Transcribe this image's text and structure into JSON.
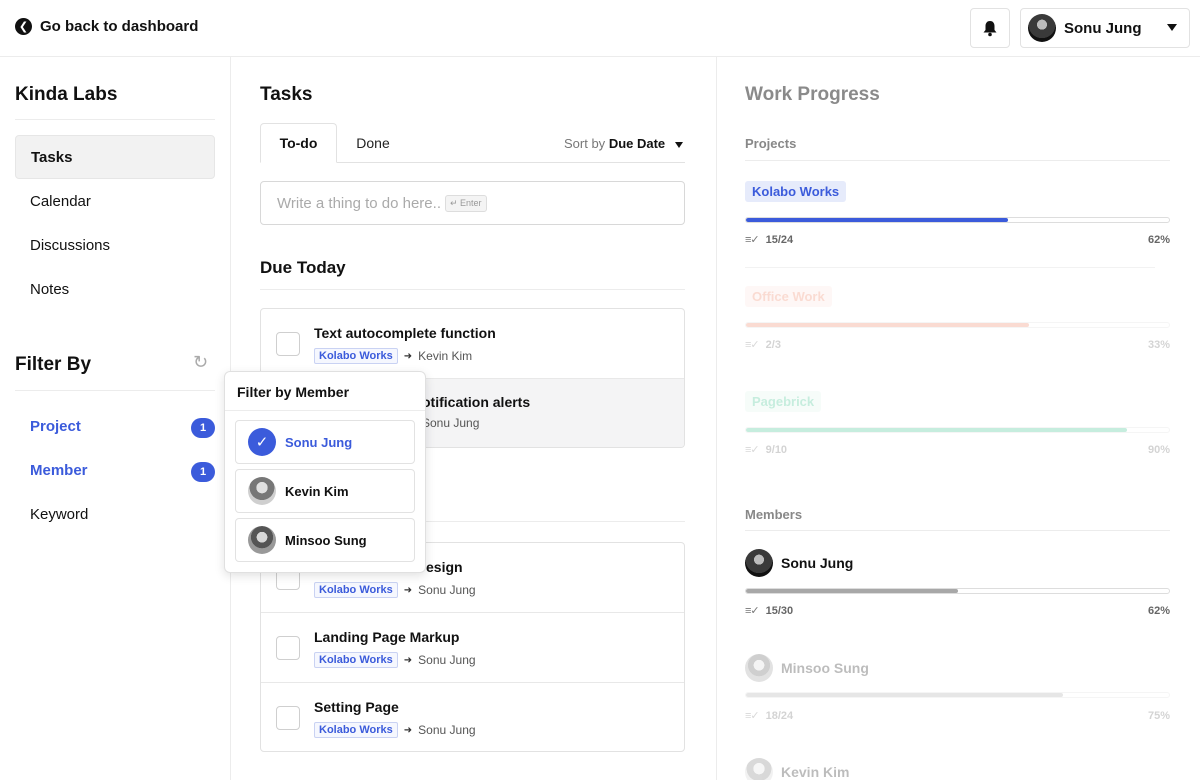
{
  "topbar": {
    "back_label": "Go back to dashboard",
    "user_name": "Sonu Jung"
  },
  "sidebar": {
    "org_name": "Kinda Labs",
    "nav": [
      {
        "label": "Tasks",
        "active": true
      },
      {
        "label": "Calendar"
      },
      {
        "label": "Discussions"
      },
      {
        "label": "Notes"
      }
    ],
    "filter_title": "Filter By",
    "filters": [
      {
        "label": "Project",
        "count": "1"
      },
      {
        "label": "Member",
        "count": "1"
      },
      {
        "label": "Keyword"
      }
    ]
  },
  "tasks": {
    "title": "Tasks",
    "tabs": [
      {
        "label": "To-do"
      },
      {
        "label": "Done"
      }
    ],
    "sort_prefix": "Sort by",
    "sort_value": "Due Date",
    "input_placeholder": "Write a thing to do here..",
    "enter_hint": "↵ Enter",
    "due_today_title": "Due Today",
    "due_today": [
      {
        "title": "Text autocomplete function",
        "project": "Kolabo Works",
        "assignee": "Kevin Kim"
      },
      {
        "title": "otification alerts",
        "project": "",
        "assignee": "Sonu Jung"
      }
    ],
    "later": [
      {
        "title": "esign",
        "project": "Kolabo Works",
        "assignee": "Sonu Jung"
      },
      {
        "title": "Landing Page Markup",
        "project": "Kolabo Works",
        "assignee": "Sonu Jung"
      },
      {
        "title": "Setting Page",
        "project": "Kolabo Works",
        "assignee": "Sonu Jung"
      }
    ]
  },
  "popover": {
    "title": "Filter by Member",
    "members": [
      {
        "name": "Sonu Jung",
        "selected": true
      },
      {
        "name": "Kevin Kim"
      },
      {
        "name": "Minsoo Sung"
      }
    ]
  },
  "progress": {
    "title": "Work Progress",
    "projects_label": "Projects",
    "projects": [
      {
        "name": "Kolabo Works",
        "done": "15/24",
        "pct": "62%",
        "fraction": 0.62,
        "color": "#3b5bdb",
        "bg": "#e6ebfb"
      },
      {
        "name": "Office Work",
        "done": "2/3",
        "pct": "33%",
        "fraction": 0.67,
        "color": "#f08060",
        "bg": "#fde6df"
      },
      {
        "name": "Pagebrick",
        "done": "9/10",
        "pct": "90%",
        "fraction": 0.9,
        "color": "#36c28a",
        "bg": "#dff5ea"
      }
    ],
    "members_label": "Members",
    "members": [
      {
        "name": "Sonu Jung",
        "done": "15/30",
        "pct": "62%",
        "fraction": 0.5
      },
      {
        "name": "Minsoo Sung",
        "done": "18/24",
        "pct": "75%",
        "fraction": 0.75
      },
      {
        "name": "Kevin Kim"
      }
    ]
  }
}
